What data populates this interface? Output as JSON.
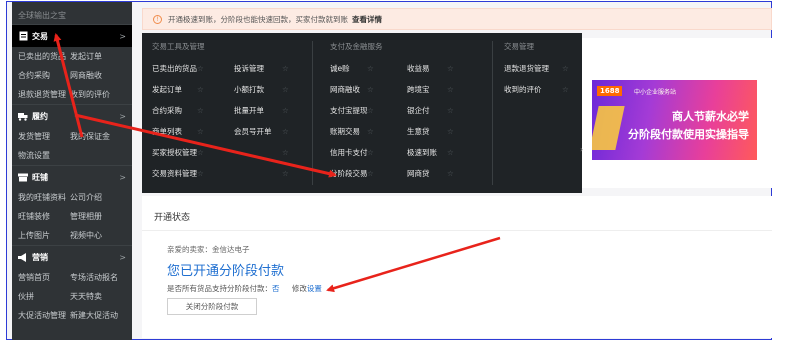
{
  "sidebar": {
    "top_label": "全球输出之宝",
    "groups": [
      {
        "title": "交易",
        "icon": "document-icon",
        "active": true,
        "rows": [
          [
            "已卖出的货品",
            "发起订单"
          ],
          [
            "合约采购",
            "网商融收"
          ],
          [
            "退款退货管理",
            "收到的评价"
          ]
        ]
      },
      {
        "title": "履约",
        "icon": "truck-icon",
        "active": false,
        "rows": [
          [
            "发货管理",
            "我的保证金"
          ],
          [
            "物流设置",
            ""
          ]
        ]
      },
      {
        "title": "旺铺",
        "icon": "shop-icon",
        "active": false,
        "rows": [
          [
            "我的旺铺资料",
            "公司介绍"
          ],
          [
            "旺铺装修",
            "管理相册"
          ],
          [
            "上传图片",
            "视频中心"
          ]
        ]
      },
      {
        "title": "营销",
        "icon": "megaphone-icon",
        "active": false,
        "rows": [
          [
            "营销首页",
            "专场活动报名"
          ],
          [
            "伙拼",
            "天天特卖"
          ],
          [
            "大促活动管理",
            "新建大促活动"
          ]
        ]
      }
    ]
  },
  "notice": {
    "text": "开通极速到账，分阶段也能快速回款，买家付款就到账",
    "link": "查看详情"
  },
  "dropdown": {
    "columns": [
      {
        "title": "交易工具及管理",
        "items": [
          "已卖出的货品",
          "投诉管理",
          "发起订单",
          "小额打款",
          "合约采购",
          "批量开单",
          "商单列表",
          "会员号开单",
          "买家授权管理",
          "",
          "交易资料管理",
          ""
        ]
      },
      {
        "title": "支付及金融服务",
        "items": [
          "诚e赊",
          "收益易",
          "网商融收",
          "跨境宝",
          "支付宝提现",
          "银企付",
          "账期交易",
          "生意贷",
          "信用卡支付",
          "极速到账",
          "分阶段交易",
          "网商贷"
        ]
      },
      {
        "title": "交易管理",
        "items": [
          "退款退货管理",
          "收到的评价"
        ]
      }
    ]
  },
  "status_card": {
    "title": "开通状态",
    "seller": "亲爱的卖家：金信达电子",
    "headline": "您已开通分阶段付款",
    "support_q": "是否所有货品支持分阶段付款：",
    "support_a": "否",
    "modify": "修改",
    "settings_link": "设置",
    "close_button": "关闭分阶段付款"
  },
  "banner": {
    "tag": "1688",
    "tag_sub": "中小企业服务站",
    "line1": "商人节薪水必学",
    "line2": "分阶段付款使用实操指导"
  },
  "colors": {
    "sidebar_bg": "#2f3336",
    "dropdown_bg": "#1f2326",
    "link_blue": "#1f6fd0",
    "annotation_red": "#e8231b",
    "frame_blue": "#2d3bd6"
  }
}
